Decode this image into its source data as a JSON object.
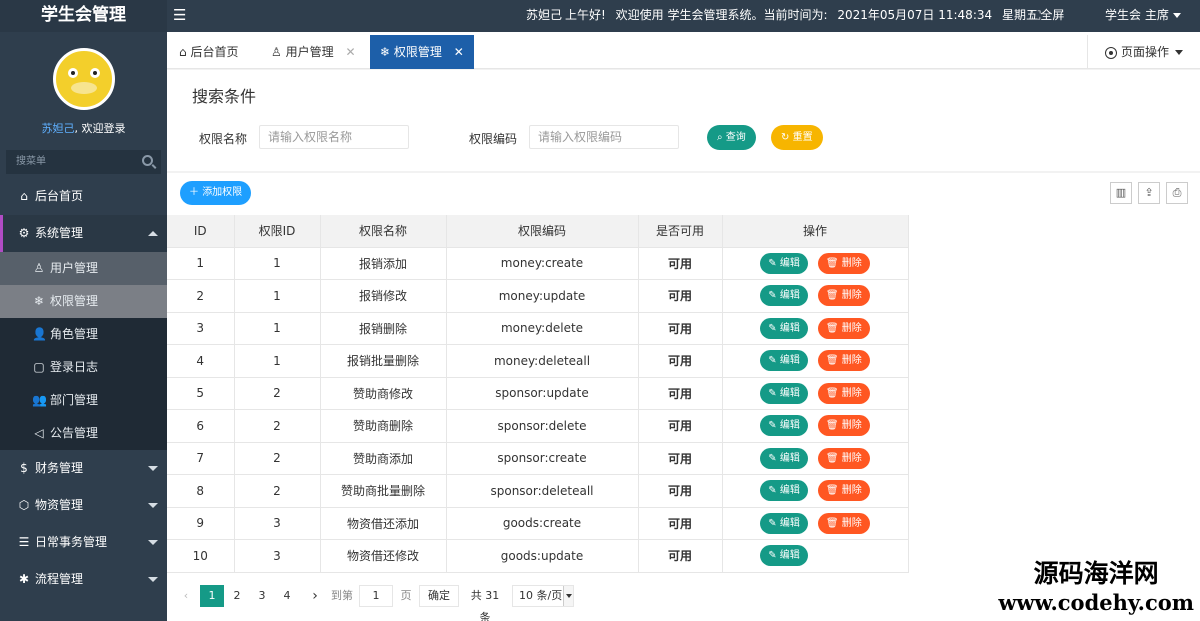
{
  "sidebar": {
    "app_title": "学生会管理",
    "username": "苏妲己",
    "welcome_suffix": ", 欢迎登录",
    "search_placeholder": "搜菜单",
    "menu": [
      {
        "icon": "home-icon",
        "glyph": "⌂",
        "label": "后台首页"
      },
      {
        "icon": "gear-icon",
        "glyph": "⚙",
        "label": "系统管理",
        "expanded": true,
        "children": [
          {
            "icon": "user-icon",
            "glyph": "♙",
            "label": "用户管理"
          },
          {
            "icon": "snowflake-icon",
            "glyph": "❄",
            "label": "权限管理"
          },
          {
            "icon": "person-icon",
            "glyph": "👤",
            "label": "角色管理"
          },
          {
            "icon": "document-icon",
            "glyph": "▢",
            "label": "登录日志"
          },
          {
            "icon": "group-icon",
            "glyph": "👥",
            "label": "部门管理"
          },
          {
            "icon": "announce-icon",
            "glyph": "◁",
            "label": "公告管理"
          }
        ]
      },
      {
        "icon": "dollar-icon",
        "glyph": "$",
        "label": "财务管理"
      },
      {
        "icon": "cube-icon",
        "glyph": "⬡",
        "label": "物资管理"
      },
      {
        "icon": "sliders-icon",
        "glyph": "☰",
        "label": "日常事务管理"
      },
      {
        "icon": "flow-icon",
        "glyph": "✱",
        "label": "流程管理"
      }
    ]
  },
  "topbar": {
    "menu_icon": "hamburger-icon",
    "greeting_user": "苏妲己",
    "greeting": "上午好!",
    "welcome_text": "欢迎使用 学生会管理系统。当前时间为:",
    "datetime": "2021年05月07日 11:48:34",
    "weekday": "星期五",
    "fullscreen_label": "全屏",
    "user_menu_label": "学生会 主席"
  },
  "tabs": [
    {
      "icon": "home-icon",
      "glyph": "⌂",
      "label": "后台首页",
      "closable": false
    },
    {
      "icon": "user-icon",
      "glyph": "♙",
      "label": "用户管理",
      "closable": true
    },
    {
      "icon": "snowflake-icon",
      "glyph": "❄",
      "label": "权限管理",
      "closable": true,
      "active": true
    }
  ],
  "page_ops_label": "页面操作",
  "search": {
    "title": "搜索条件",
    "name_label": "权限名称",
    "name_placeholder": "请输入权限名称",
    "code_label": "权限编码",
    "code_placeholder": "请输入权限编码",
    "search_button": "查询",
    "reset_button": "重置"
  },
  "toolbar": {
    "add_button": "添加权限",
    "icons": [
      "columns-icon",
      "export-icon",
      "print-icon"
    ]
  },
  "table": {
    "columns": [
      "ID",
      "权限ID",
      "权限名称",
      "权限编码",
      "是否可用",
      "操作"
    ],
    "edit_label": "编辑",
    "delete_label": "删除",
    "rows": [
      {
        "id": "1",
        "pid": "1",
        "name": "报销添加",
        "code": "money:create",
        "enabled": "可用",
        "deletable": true
      },
      {
        "id": "2",
        "pid": "1",
        "name": "报销修改",
        "code": "money:update",
        "enabled": "可用",
        "deletable": true
      },
      {
        "id": "3",
        "pid": "1",
        "name": "报销删除",
        "code": "money:delete",
        "enabled": "可用",
        "deletable": true
      },
      {
        "id": "4",
        "pid": "1",
        "name": "报销批量删除",
        "code": "money:deleteall",
        "enabled": "可用",
        "deletable": true
      },
      {
        "id": "5",
        "pid": "2",
        "name": "赞助商修改",
        "code": "sponsor:update",
        "enabled": "可用",
        "deletable": true
      },
      {
        "id": "6",
        "pid": "2",
        "name": "赞助商删除",
        "code": "sponsor:delete",
        "enabled": "可用",
        "deletable": true
      },
      {
        "id": "7",
        "pid": "2",
        "name": "赞助商添加",
        "code": "sponsor:create",
        "enabled": "可用",
        "deletable": true
      },
      {
        "id": "8",
        "pid": "2",
        "name": "赞助商批量删除",
        "code": "sponsor:deleteall",
        "enabled": "可用",
        "deletable": true
      },
      {
        "id": "9",
        "pid": "3",
        "name": "物资借还添加",
        "code": "goods:create",
        "enabled": "可用",
        "deletable": true
      },
      {
        "id": "10",
        "pid": "3",
        "name": "物资借还修改",
        "code": "goods:update",
        "enabled": "可用",
        "deletable": false
      }
    ]
  },
  "pager": {
    "pages": [
      "1",
      "2",
      "3",
      "4"
    ],
    "current": "1",
    "goto_label": "到第",
    "goto_value": "1",
    "page_unit": "页",
    "confirm": "确定",
    "total": "共 31 条",
    "page_size": "10 条/页"
  },
  "watermark": {
    "line1": "源码海洋网",
    "line2": "www.codehy.com"
  },
  "colors": {
    "sidebar_bg": "#2f3e4d",
    "tab_active": "#1d5fa9",
    "teal": "#159a87",
    "orange": "#ff5722",
    "yellow": "#f7b500",
    "blue": "#1e9fff"
  }
}
